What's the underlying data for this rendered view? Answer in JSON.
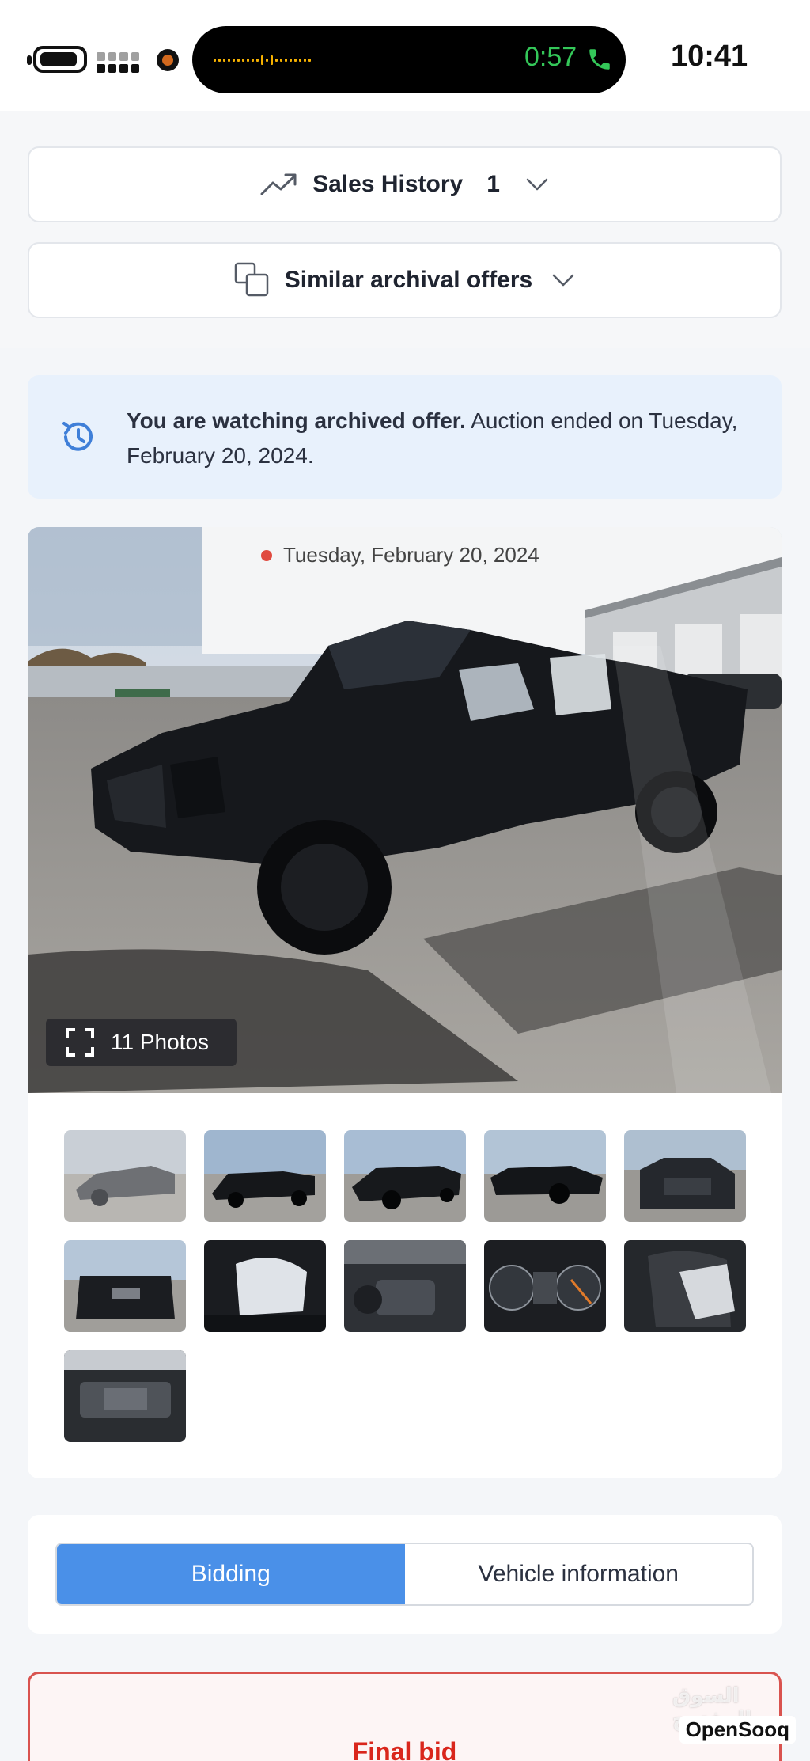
{
  "status_bar": {
    "call_time": "0:57",
    "clock": "10:41",
    "call_color": "#34c759"
  },
  "sales_history": {
    "label": "Sales History",
    "count": "1",
    "icon": "trending-up-icon"
  },
  "similar_offers": {
    "label": "Similar archival offers",
    "icon": "copy-icon"
  },
  "notice": {
    "bold": "You are watching archived offer.",
    "rest": " Auction ended on Tuesday, February 20, 2024.",
    "icon": "history-icon",
    "background": "#e8f1fc"
  },
  "gallery": {
    "date": "Tuesday, February 20, 2024",
    "photo_count": "11 Photos",
    "thumbnails": [
      {
        "name": "thumb-front-left-pale"
      },
      {
        "name": "thumb-side-left"
      },
      {
        "name": "thumb-rear-left"
      },
      {
        "name": "thumb-front-right"
      },
      {
        "name": "thumb-front"
      },
      {
        "name": "thumb-rear"
      },
      {
        "name": "thumb-door-airbag"
      },
      {
        "name": "thumb-interior-console"
      },
      {
        "name": "thumb-gauge-cluster"
      },
      {
        "name": "thumb-rear-seat"
      },
      {
        "name": "thumb-engine-bay"
      }
    ]
  },
  "tabs": {
    "items": [
      {
        "label": "Bidding",
        "active": true
      },
      {
        "label": "Vehicle information",
        "active": false
      }
    ],
    "accent": "#4a90e8"
  },
  "final_bid": {
    "title": "Final bid",
    "accent": "#d9261c"
  },
  "watermark": {
    "arabic": "السوق المفتوح",
    "english": "OpenSooq"
  }
}
